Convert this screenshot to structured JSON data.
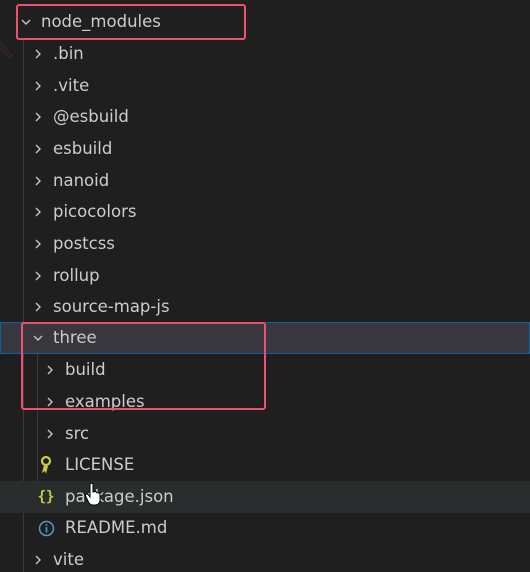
{
  "explorer": {
    "items": [
      {
        "label": "node_modules",
        "kind": "folder",
        "expanded": true,
        "icon": "chevron-down-icon"
      },
      {
        "label": ".bin",
        "kind": "folder",
        "expanded": false,
        "icon": "chevron-right-icon"
      },
      {
        "label": ".vite",
        "kind": "folder",
        "expanded": false,
        "icon": "chevron-right-icon"
      },
      {
        "label": "@esbuild",
        "kind": "folder",
        "expanded": false,
        "icon": "chevron-right-icon"
      },
      {
        "label": "esbuild",
        "kind": "folder",
        "expanded": false,
        "icon": "chevron-right-icon"
      },
      {
        "label": "nanoid",
        "kind": "folder",
        "expanded": false,
        "icon": "chevron-right-icon"
      },
      {
        "label": "picocolors",
        "kind": "folder",
        "expanded": false,
        "icon": "chevron-right-icon"
      },
      {
        "label": "postcss",
        "kind": "folder",
        "expanded": false,
        "icon": "chevron-right-icon"
      },
      {
        "label": "rollup",
        "kind": "folder",
        "expanded": false,
        "icon": "chevron-right-icon"
      },
      {
        "label": "source-map-js",
        "kind": "folder",
        "expanded": false,
        "icon": "chevron-right-icon"
      },
      {
        "label": "three",
        "kind": "folder",
        "expanded": true,
        "selected": true,
        "icon": "chevron-down-icon"
      },
      {
        "label": "build",
        "kind": "folder",
        "expanded": false,
        "icon": "chevron-right-icon"
      },
      {
        "label": "examples",
        "kind": "folder",
        "expanded": false,
        "icon": "chevron-right-icon"
      },
      {
        "label": "src",
        "kind": "folder",
        "expanded": false,
        "icon": "chevron-right-icon"
      },
      {
        "label": "LICENSE",
        "kind": "file",
        "icon": "license-key-icon",
        "icon_color": "#cbcb41"
      },
      {
        "label": "package.json",
        "kind": "file",
        "hovered": true,
        "icon": "json-braces-icon",
        "icon_color": "#cbcb41"
      },
      {
        "label": "README.md",
        "kind": "file",
        "icon": "info-icon",
        "icon_color": "#519aba"
      },
      {
        "label": "vite",
        "kind": "folder",
        "expanded": false,
        "icon": "chevron-right-icon"
      }
    ]
  },
  "colors": {
    "background": "#1f1f1f",
    "text": "#cccccc",
    "selection_border": "#0e639c",
    "annotation_red": "#f0506e"
  }
}
